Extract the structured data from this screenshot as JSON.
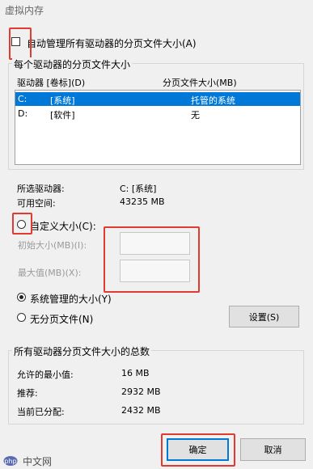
{
  "window": {
    "title": "虚拟内存"
  },
  "auto_manage": {
    "label": "自动管理所有驱动器的分页文件大小(A)"
  },
  "per_drive_group": {
    "legend": "每个驱动器的分页文件大小",
    "columns": [
      "驱动器 [卷标](D)",
      "分页文件大小(MB)"
    ],
    "drives": [
      {
        "drive": "C:",
        "label": "[系统]",
        "size": "托管的系统"
      },
      {
        "drive": "D:",
        "label": "[软件]",
        "size": "无"
      }
    ]
  },
  "selected_drive": {
    "label": "所选驱动器:",
    "value": "C:  [系统]"
  },
  "free_space": {
    "label": "可用空间:",
    "value": "43235 MB"
  },
  "custom_size": {
    "label": "自定义大小(C):",
    "initial_label": "初始大小(MB)(I):",
    "initial_value": "",
    "max_label": "最大值(MB)(X):",
    "max_value": ""
  },
  "system_managed": {
    "label": "系统管理的大小(Y)"
  },
  "no_paging": {
    "label": "无分页文件(N)"
  },
  "set_button": "设置(S)",
  "totals_group": {
    "legend": "所有驱动器分页文件大小的总数",
    "rows": [
      {
        "label": "允许的最小值:",
        "value": "16 MB"
      },
      {
        "label": "推荐:",
        "value": "2932 MB"
      },
      {
        "label": "当前已分配:",
        "value": "2432 MB"
      }
    ]
  },
  "buttons": {
    "ok": "确定",
    "cancel": "取消"
  },
  "watermark": {
    "icon": "php-logo-icon",
    "text": "中文网"
  },
  "colors": {
    "accent": "#0078d7",
    "highlight": "#e23a2f"
  }
}
